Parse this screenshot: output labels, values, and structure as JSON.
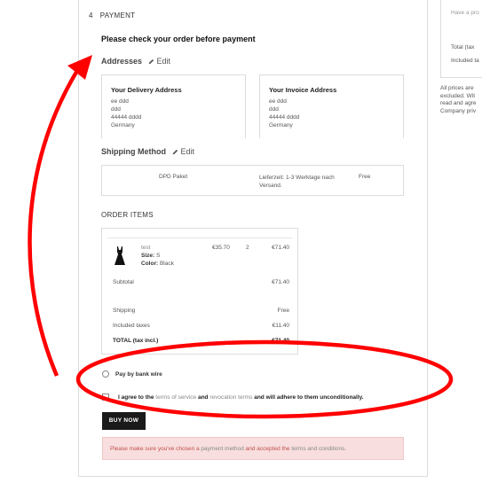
{
  "step": {
    "number": "4",
    "label": "PAYMENT"
  },
  "check_title": "Please check your order before payment",
  "addresses": {
    "title": "Addresses",
    "edit_label": "Edit",
    "delivery": {
      "title": "Your Delivery Address",
      "lines": [
        "ee ddd",
        "ddd",
        "44444 dddd",
        "Germany"
      ]
    },
    "invoice": {
      "title": "Your Invoice Address",
      "lines": [
        "ee ddd",
        "ddd",
        "44444 dddd",
        "Germany"
      ]
    }
  },
  "shipping": {
    "title": "Shipping Method",
    "edit_label": "Edit",
    "method": "DPD Paket",
    "delivery_time": "Lieferzeit: 1-3 Werktage nach Versand.",
    "price": "Free"
  },
  "order_items": {
    "title": "ORDER ITEMS",
    "item": {
      "name": "test",
      "size_label": "Size:",
      "size_value": "S",
      "color_label": "Color:",
      "color_value": "Black",
      "unit_price": "€35.70",
      "quantity": "2",
      "total": "€71.40"
    },
    "subtotal": {
      "label": "Subtotal",
      "value": "€71.40"
    },
    "shipping": {
      "label": "Shipping",
      "value": "Free"
    },
    "taxes": {
      "label": "Included taxes",
      "value": "€11.40"
    },
    "total": {
      "label": "TOTAL (tax incl.)",
      "value": "€71.40"
    }
  },
  "payment_option": "Pay by bank wire",
  "agree": {
    "part1": "I agree to the",
    "terms_link": "terms of service",
    "part2": "and",
    "revocation_link": "revocation terms",
    "part3": "and will adhere to them unconditionally."
  },
  "buy_button": "BUY NOW",
  "alert": {
    "part1": "Please make sure you've chosen a",
    "payment_link": "payment method",
    "part2": "and accepted the",
    "terms_link": "terms and conditions",
    "part3": "."
  },
  "sidebar": {
    "promo_placeholder": "Have a pro",
    "total_label": "Total (tax",
    "included_label": "Included ta",
    "notes": [
      "All prices are",
      "excluded. Wit",
      "read and agre",
      "Company priv"
    ]
  },
  "annotation_color": "#ff0000"
}
